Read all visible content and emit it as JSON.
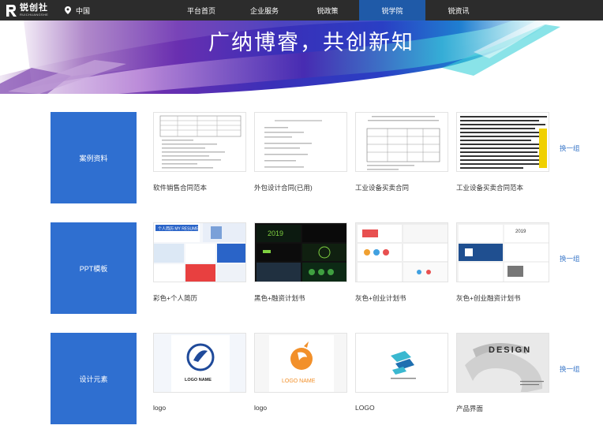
{
  "header": {
    "logo_title": "锐创社",
    "logo_sub": "RUICHUANGSHE",
    "location": "中国",
    "nav": [
      {
        "label": "平台首页",
        "active": false
      },
      {
        "label": "企业服务",
        "active": false
      },
      {
        "label": "锐政策",
        "active": false
      },
      {
        "label": "锐学院",
        "active": true
      },
      {
        "label": "锐资讯",
        "active": false
      }
    ]
  },
  "banner": {
    "title": "广纳博睿，共创新知"
  },
  "sections": [
    {
      "category": "案例资料",
      "refresh_label": "换一组",
      "items": [
        {
          "caption": "软件销售合同范本"
        },
        {
          "caption": "外包设计合同(已用)"
        },
        {
          "caption": "工业设备买卖合同"
        },
        {
          "caption": "工业设备买卖合同范本"
        }
      ]
    },
    {
      "category": "PPT模板",
      "refresh_label": "换一组",
      "items": [
        {
          "caption": "彩色+个人简历",
          "thumb_text": "个人简历 MY RESUME"
        },
        {
          "caption": "黑色+融资计划书",
          "thumb_text": "2019"
        },
        {
          "caption": "灰色+创业计划书"
        },
        {
          "caption": "灰色+创业融资计划书",
          "thumb_text": "2019"
        }
      ]
    },
    {
      "category": "设计元素",
      "refresh_label": "换一组",
      "items": [
        {
          "caption": "logo",
          "thumb_text": "LOGO NAME"
        },
        {
          "caption": "logo",
          "thumb_text": "LOGO NAME"
        },
        {
          "caption": "LOGO"
        },
        {
          "caption": "产品界面",
          "thumb_text": "DESIGN"
        }
      ]
    }
  ],
  "colors": {
    "topbar": "#2c2c2c",
    "nav_active": "#1f5aa8",
    "category_tile": "#2f6fd0",
    "refresh_link": "#3b78c9"
  },
  "icons": {
    "location": "map-pin-icon",
    "logo": "r-logo-icon"
  }
}
